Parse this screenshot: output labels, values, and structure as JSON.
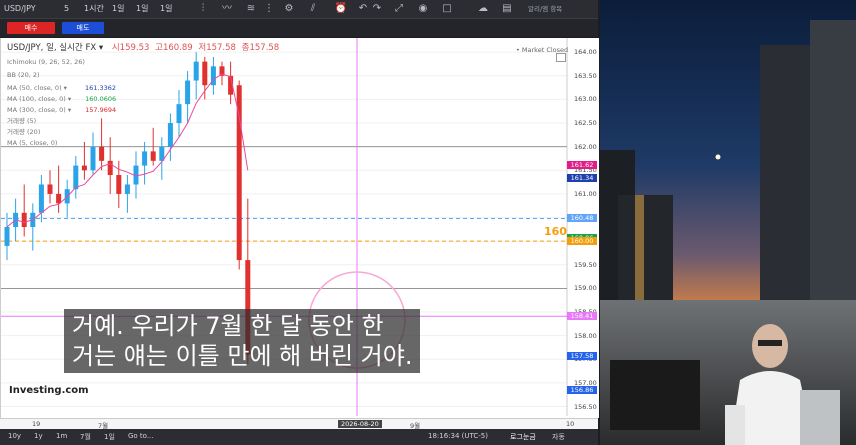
{
  "toolbar": {
    "symbol": "USD/JPY",
    "interval_num": "5",
    "intervals": [
      "1시간",
      "1일",
      "1일",
      "1일"
    ],
    "layout_label": "알리/엠 항목"
  },
  "trade": {
    "sell": "매수",
    "buy": "매도"
  },
  "legend": {
    "title": "USD/JPY, 일, 실시간 FX",
    "open": "시159.53",
    "high": "고160.89",
    "low": "저157.58",
    "close": "종157.58",
    "market_status": "Market Closed",
    "indicators": [
      {
        "label": "Ichimoku (9, 26, 52, 26)",
        "value": ""
      },
      {
        "label": "BB (20, 2)",
        "value": ""
      },
      {
        "label": "MA (50, close, 0)",
        "value": "161.3362",
        "color": "#1e40af"
      },
      {
        "label": "MA (100, close, 0)",
        "value": "160.0606",
        "color": "#16a34a"
      },
      {
        "label": "MA (300, close, 0)",
        "value": "157.9694",
        "color": "#dc2626"
      },
      {
        "label": "거래량 (5)",
        "value": ""
      },
      {
        "label": "거래량 (20)",
        "value": ""
      },
      {
        "label": "MA (5, close, 0)",
        "value": ""
      }
    ]
  },
  "annotation_160": "160",
  "price_ticks": [
    "164.00",
    "163.50",
    "163.00",
    "162.50",
    "162.00",
    "161.50",
    "161.00",
    "160.50",
    "160.00",
    "159.50",
    "159.00",
    "158.50",
    "158.00",
    "157.50",
    "157.00",
    "156.50"
  ],
  "price_labels": [
    {
      "text": "161.62",
      "color": "#e11d89",
      "price": 161.62
    },
    {
      "text": "161.34",
      "color": "#1e40af",
      "price": 161.34
    },
    {
      "text": "160.48",
      "color": "#60a5fa",
      "price": 160.48
    },
    {
      "text": "160.06",
      "color": "#16a34a",
      "price": 160.06
    },
    {
      "text": "160.00",
      "color": "#f59e0b",
      "price": 160.0
    },
    {
      "text": "158.41",
      "color": "#e879f9",
      "price": 158.41
    },
    {
      "text": "157.57",
      "color": "#dc2626",
      "price": 157.57
    },
    {
      "text": "157.58",
      "color": "#2563eb",
      "price": 157.58
    },
    {
      "text": "156.86",
      "color": "#2563eb",
      "price": 156.86
    }
  ],
  "time_labels": [
    "19",
    "7월",
    "2026-08-20",
    "9월",
    "10"
  ],
  "watermark": "Investing.com",
  "bottom": {
    "ranges": [
      "10y",
      "1y",
      "1m",
      "7월",
      "1일",
      "Go to..."
    ],
    "clock": "18:16:34 (UTC-5)",
    "log_label": "로그눈금",
    "auto_label": "자동"
  },
  "subtitle": {
    "line1": "거예. 우리가 7월 한 달 동안 한",
    "line2": "거는 얘는 이틀 만에 해 버린 거야."
  },
  "chart_data": {
    "type": "candlestick",
    "y_range": [
      156.3,
      164.3
    ],
    "candles": [
      [
        159.9,
        160.6,
        159.6,
        160.3
      ],
      [
        160.3,
        160.9,
        160.0,
        160.6
      ],
      [
        160.6,
        161.2,
        160.1,
        160.3
      ],
      [
        160.3,
        160.8,
        159.8,
        160.6
      ],
      [
        160.6,
        161.4,
        160.4,
        161.2
      ],
      [
        161.2,
        161.5,
        160.8,
        161.0
      ],
      [
        161.0,
        161.6,
        160.6,
        160.8
      ],
      [
        160.8,
        161.3,
        160.5,
        161.1
      ],
      [
        161.1,
        161.8,
        160.9,
        161.6
      ],
      [
        161.6,
        162.1,
        161.3,
        161.5
      ],
      [
        161.5,
        162.3,
        161.4,
        162.0
      ],
      [
        162.0,
        162.6,
        161.5,
        161.7
      ],
      [
        161.7,
        162.2,
        161.0,
        161.4
      ],
      [
        161.4,
        161.7,
        160.7,
        161.0
      ],
      [
        161.0,
        161.4,
        160.6,
        161.2
      ],
      [
        161.2,
        161.9,
        160.9,
        161.6
      ],
      [
        161.6,
        162.1,
        161.2,
        161.9
      ],
      [
        161.9,
        162.4,
        161.6,
        161.7
      ],
      [
        161.7,
        162.2,
        161.3,
        162.0
      ],
      [
        162.0,
        162.7,
        161.7,
        162.5
      ],
      [
        162.5,
        163.2,
        162.2,
        162.9
      ],
      [
        162.9,
        163.6,
        162.5,
        163.4
      ],
      [
        163.4,
        164.0,
        163.0,
        163.8
      ],
      [
        163.8,
        163.9,
        163.0,
        163.3
      ],
      [
        163.3,
        163.9,
        163.1,
        163.7
      ],
      [
        163.7,
        163.8,
        163.3,
        163.5
      ],
      [
        163.5,
        163.8,
        162.9,
        163.1
      ],
      [
        163.3,
        163.4,
        159.4,
        159.6
      ],
      [
        159.6,
        160.9,
        157.4,
        157.6
      ]
    ]
  }
}
